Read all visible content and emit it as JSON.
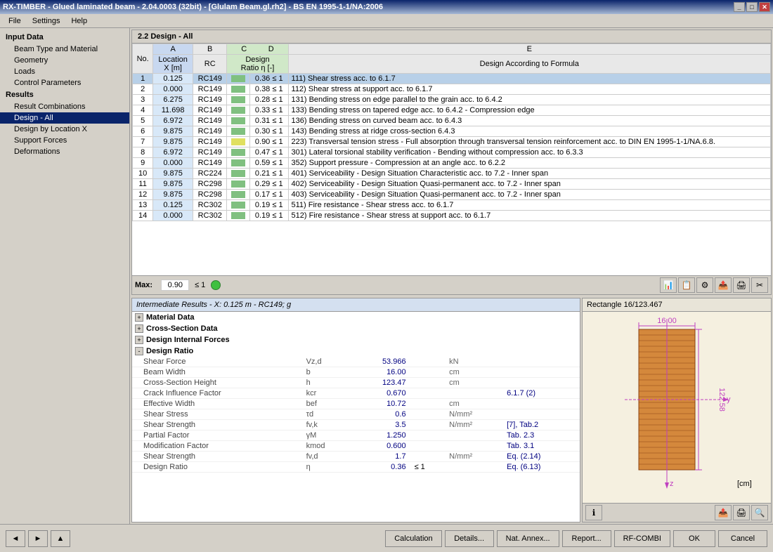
{
  "titlebar": {
    "title": "RX-TIMBER - Glued laminated beam - 2.04.0003 (32bit) - [Glulam Beam.gl.rh2] - BS EN 1995-1-1/NA:2006"
  },
  "menu": {
    "items": [
      "File",
      "Settings",
      "Help"
    ]
  },
  "left_panel": {
    "sections": [
      {
        "label": "Input Data",
        "items": [
          {
            "label": "Beam Type and Material",
            "active": false
          },
          {
            "label": "Geometry",
            "active": false
          },
          {
            "label": "Loads",
            "active": false
          },
          {
            "label": "Control Parameters",
            "active": false
          }
        ]
      },
      {
        "label": "Results",
        "items": [
          {
            "label": "Result Combinations",
            "active": false
          },
          {
            "label": "Design - All",
            "active": true
          },
          {
            "label": "Design by Location X",
            "active": false
          },
          {
            "label": "Support Forces",
            "active": false
          },
          {
            "label": "Deformations",
            "active": false
          }
        ]
      }
    ]
  },
  "main_title": "2.2 Design - All",
  "table": {
    "col_headers": [
      "A",
      "B",
      "C",
      "D",
      "E"
    ],
    "sub_headers": [
      "Location X [m]",
      "RC",
      "Design Ratio η [-]",
      "",
      "Design According to Formula"
    ],
    "no_label": "No.",
    "rows": [
      {
        "no": 1,
        "location": "0.125",
        "rc": "RC149",
        "ratio": "0.36",
        "le": "≤ 1",
        "formula": "111) Shear stress acc. to 6.1.7",
        "selected": true
      },
      {
        "no": 2,
        "location": "0.000",
        "rc": "RC149",
        "ratio": "0.38",
        "le": "≤ 1",
        "formula": "112) Shear stress at support acc. to 6.1.7"
      },
      {
        "no": 3,
        "location": "6.275",
        "rc": "RC149",
        "ratio": "0.28",
        "le": "≤ 1",
        "formula": "131) Bending stress on edge parallel to the grain acc. to 6.4.2"
      },
      {
        "no": 4,
        "location": "11.698",
        "rc": "RC149",
        "ratio": "0.33",
        "le": "≤ 1",
        "formula": "133) Bending stress on tapered edge acc. to 6.4.2 - Compression edge"
      },
      {
        "no": 5,
        "location": "6.972",
        "rc": "RC149",
        "ratio": "0.31",
        "le": "≤ 1",
        "formula": "136) Bending stress on curved beam acc. to 6.4.3"
      },
      {
        "no": 6,
        "location": "9.875",
        "rc": "RC149",
        "ratio": "0.30",
        "le": "≤ 1",
        "formula": "143) Bending stress at ridge cross-section 6.4.3"
      },
      {
        "no": 7,
        "location": "9.875",
        "rc": "RC149",
        "ratio": "0.90",
        "le": "≤ 1",
        "formula": "223) Transversal tension stress - Full absorption through transversal tension reinforcement acc. to DIN EN 1995-1-1/NA.6.8.",
        "yellow": true
      },
      {
        "no": 8,
        "location": "6.972",
        "rc": "RC149",
        "ratio": "0.47",
        "le": "≤ 1",
        "formula": "301) Lateral torsional stability verification - Bending without compression acc. to 6.3.3"
      },
      {
        "no": 9,
        "location": "0.000",
        "rc": "RC149",
        "ratio": "0.59",
        "le": "≤ 1",
        "formula": "352) Support pressure - Compression at an angle acc. to 6.2.2"
      },
      {
        "no": 10,
        "location": "9.875",
        "rc": "RC224",
        "ratio": "0.21",
        "le": "≤ 1",
        "formula": "401) Serviceability - Design Situation Characteristic acc. to 7.2 - Inner span"
      },
      {
        "no": 11,
        "location": "9.875",
        "rc": "RC298",
        "ratio": "0.29",
        "le": "≤ 1",
        "formula": "402) Serviceability - Design Situation Quasi-permanent acc. to 7.2 - Inner span"
      },
      {
        "no": 12,
        "location": "9.875",
        "rc": "RC298",
        "ratio": "0.17",
        "le": "≤ 1",
        "formula": "403) Serviceability - Design Situation Quasi-permanent acc. to 7.2 - Inner span"
      },
      {
        "no": 13,
        "location": "0.125",
        "rc": "RC302",
        "ratio": "0.19",
        "le": "≤ 1",
        "formula": "511) Fire resistance - Shear stress acc. to 6.1.7"
      },
      {
        "no": 14,
        "location": "0.000",
        "rc": "RC302",
        "ratio": "0.19",
        "le": "≤ 1",
        "formula": "512) Fire resistance - Shear stress at support acc. to 6.1.7"
      }
    ],
    "max_label": "Max:",
    "max_value": "0.90",
    "max_le": "≤ 1"
  },
  "intermediate": {
    "header": "Intermediate Results  -  X: 0.125 m  -  RC149; g",
    "sections": [
      {
        "label": "Material Data",
        "expanded": false
      },
      {
        "label": "Cross-Section Data",
        "expanded": false
      },
      {
        "label": "Design Internal Forces",
        "expanded": false
      },
      {
        "label": "Design Ratio",
        "expanded": true
      }
    ],
    "design_ratio": {
      "rows": [
        {
          "name": "Shear Force",
          "symbol": "Vz,d",
          "value": "53.966",
          "unit": "kN",
          "ref": ""
        },
        {
          "name": "Beam Width",
          "symbol": "b",
          "value": "16.00",
          "unit": "cm",
          "ref": ""
        },
        {
          "name": "Cross-Section Height",
          "symbol": "h",
          "value": "123.47",
          "unit": "cm",
          "ref": ""
        },
        {
          "name": "Crack Influence Factor",
          "symbol": "kcr",
          "value": "0.670",
          "unit": "",
          "ref": "6.1.7 (2)"
        },
        {
          "name": "Effective Width",
          "symbol": "bef",
          "value": "10.72",
          "unit": "cm",
          "ref": ""
        },
        {
          "name": "Shear Stress",
          "symbol": "τd",
          "value": "0.6",
          "unit": "N/mm²",
          "ref": ""
        },
        {
          "name": "Shear Strength",
          "symbol": "fv,k",
          "value": "3.5",
          "unit": "N/mm²",
          "ref": "[7], Tab.2"
        },
        {
          "name": "Partial Factor",
          "symbol": "γM",
          "value": "1.250",
          "unit": "",
          "ref": "Tab. 2.3"
        },
        {
          "name": "Modification Factor",
          "symbol": "kmod",
          "value": "0.600",
          "unit": "",
          "ref": "Tab. 3.1"
        },
        {
          "name": "Shear Strength",
          "symbol": "fv,d",
          "value": "1.7",
          "unit": "N/mm²",
          "ref": "Eq. (2.14)"
        },
        {
          "name": "Design Ratio",
          "symbol": "η",
          "value": "0.36",
          "unit": "",
          "le": "≤ 1",
          "ref": "Eq. (6.13)"
        }
      ]
    }
  },
  "cross_section": {
    "title": "Rectangle 16/123.467",
    "width": "16.00",
    "height": "122.58"
  },
  "toolbar_buttons": [
    "graph-icon",
    "table-icon",
    "settings-icon",
    "export-icon",
    "print-icon",
    "more-icon"
  ],
  "bottom_buttons": {
    "nav_left": "◄",
    "nav_right": "►",
    "nav_up": "▲",
    "calculation": "Calculation",
    "details": "Details...",
    "nat_annex": "Nat. Annex...",
    "report": "Report...",
    "rf_combi": "RF-COMBI",
    "ok": "OK",
    "cancel": "Cancel"
  }
}
